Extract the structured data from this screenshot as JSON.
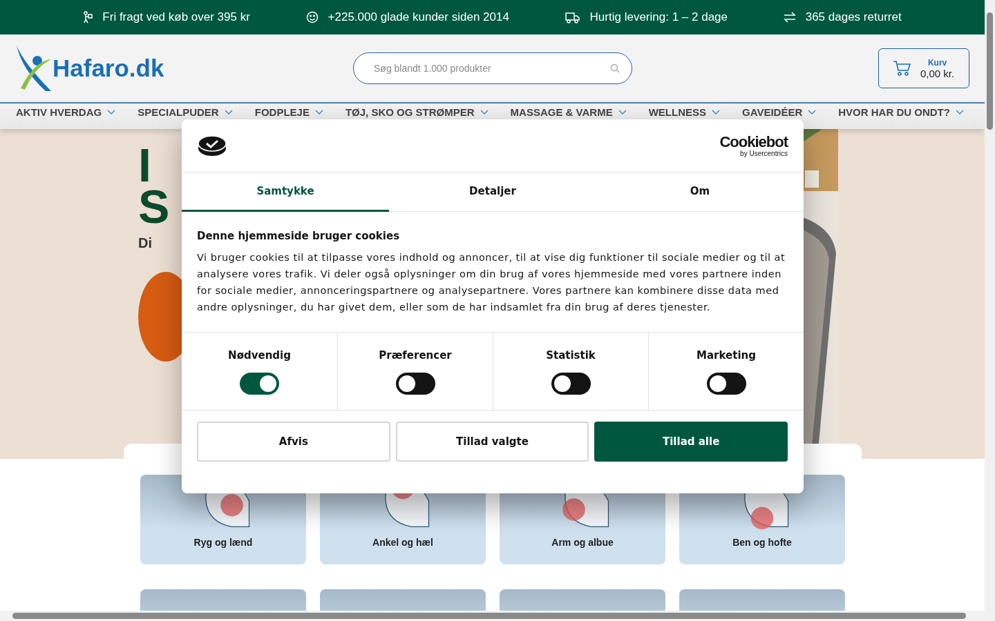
{
  "usp_bar": [
    {
      "text": "Fri fragt ved køb over 395 kr"
    },
    {
      "text": "+225.000 glade kunder siden 2014"
    },
    {
      "text": "Hurtig levering: 1 – 2 dage"
    },
    {
      "text": "365 dages returret"
    }
  ],
  "header": {
    "logo": "Hafaro.dk",
    "search": {
      "placeholder": "Søg blandt 1.000 produkter"
    },
    "cart": {
      "label": "Kurv",
      "total": "0,00 kr."
    }
  },
  "nav": [
    "AKTIV HVERDAG",
    "SPECIALPUDER",
    "FODPLEJE",
    "TØJ, SKO OG STRØMPER",
    "MASSAGE & VARME",
    "WELLNESS",
    "GAVEIDÉER",
    "HVOR HAR DU ONDT?"
  ],
  "hero": {
    "lines": [
      "I",
      "S"
    ],
    "subtitle": "Di"
  },
  "categories": [
    {
      "label": "Ryg og lænd"
    },
    {
      "label": "Ankel og hæl"
    },
    {
      "label": "Arm og albue"
    },
    {
      "label": "Ben og hofte"
    }
  ],
  "cookie_dialog": {
    "brand": "Cookiebot",
    "brand_sub": "by Usercentrics",
    "tabs": [
      {
        "label": "Samtykke",
        "selected": true
      },
      {
        "label": "Detaljer",
        "selected": false
      },
      {
        "label": "Om",
        "selected": false
      }
    ],
    "title": "Denne hjemmeside bruger cookies",
    "body": "Vi bruger cookies til at tilpasse vores indhold og annoncer, til at vise dig funktioner til sociale medier og til at analysere vores trafik. Vi deler også oplysninger om din brug af vores hjemmeside med vores partnere inden for sociale medier, annonceringspartnere og analysepartnere. Vores partnere kan kombinere disse data med andre oplysninger, du har givet dem, eller som de har indsamlet fra din brug af deres tjenester.",
    "toggles": [
      {
        "label": "Nødvendig",
        "on": true
      },
      {
        "label": "Præferencer",
        "on": false
      },
      {
        "label": "Statistik",
        "on": false
      },
      {
        "label": "Marketing",
        "on": false
      }
    ],
    "buttons": [
      {
        "label": "Afvis",
        "kind": "outline"
      },
      {
        "label": "Tillad valgte",
        "kind": "outline"
      },
      {
        "label": "Tillad alle",
        "kind": "primary"
      }
    ]
  }
}
